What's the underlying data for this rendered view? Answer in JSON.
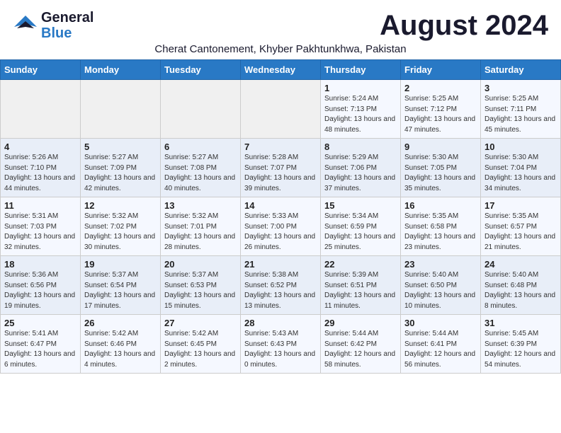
{
  "header": {
    "logo_general": "General",
    "logo_blue": "Blue",
    "month_title": "August 2024",
    "location": "Cherat Cantonement, Khyber Pakhtunkhwa, Pakistan"
  },
  "calendar": {
    "weekdays": [
      "Sunday",
      "Monday",
      "Tuesday",
      "Wednesday",
      "Thursday",
      "Friday",
      "Saturday"
    ],
    "weeks": [
      [
        {
          "day": "",
          "sunrise": "",
          "sunset": "",
          "daylight": ""
        },
        {
          "day": "",
          "sunrise": "",
          "sunset": "",
          "daylight": ""
        },
        {
          "day": "",
          "sunrise": "",
          "sunset": "",
          "daylight": ""
        },
        {
          "day": "",
          "sunrise": "",
          "sunset": "",
          "daylight": ""
        },
        {
          "day": "1",
          "sunrise": "Sunrise: 5:24 AM",
          "sunset": "Sunset: 7:13 PM",
          "daylight": "Daylight: 13 hours and 48 minutes."
        },
        {
          "day": "2",
          "sunrise": "Sunrise: 5:25 AM",
          "sunset": "Sunset: 7:12 PM",
          "daylight": "Daylight: 13 hours and 47 minutes."
        },
        {
          "day": "3",
          "sunrise": "Sunrise: 5:25 AM",
          "sunset": "Sunset: 7:11 PM",
          "daylight": "Daylight: 13 hours and 45 minutes."
        }
      ],
      [
        {
          "day": "4",
          "sunrise": "Sunrise: 5:26 AM",
          "sunset": "Sunset: 7:10 PM",
          "daylight": "Daylight: 13 hours and 44 minutes."
        },
        {
          "day": "5",
          "sunrise": "Sunrise: 5:27 AM",
          "sunset": "Sunset: 7:09 PM",
          "daylight": "Daylight: 13 hours and 42 minutes."
        },
        {
          "day": "6",
          "sunrise": "Sunrise: 5:27 AM",
          "sunset": "Sunset: 7:08 PM",
          "daylight": "Daylight: 13 hours and 40 minutes."
        },
        {
          "day": "7",
          "sunrise": "Sunrise: 5:28 AM",
          "sunset": "Sunset: 7:07 PM",
          "daylight": "Daylight: 13 hours and 39 minutes."
        },
        {
          "day": "8",
          "sunrise": "Sunrise: 5:29 AM",
          "sunset": "Sunset: 7:06 PM",
          "daylight": "Daylight: 13 hours and 37 minutes."
        },
        {
          "day": "9",
          "sunrise": "Sunrise: 5:30 AM",
          "sunset": "Sunset: 7:05 PM",
          "daylight": "Daylight: 13 hours and 35 minutes."
        },
        {
          "day": "10",
          "sunrise": "Sunrise: 5:30 AM",
          "sunset": "Sunset: 7:04 PM",
          "daylight": "Daylight: 13 hours and 34 minutes."
        }
      ],
      [
        {
          "day": "11",
          "sunrise": "Sunrise: 5:31 AM",
          "sunset": "Sunset: 7:03 PM",
          "daylight": "Daylight: 13 hours and 32 minutes."
        },
        {
          "day": "12",
          "sunrise": "Sunrise: 5:32 AM",
          "sunset": "Sunset: 7:02 PM",
          "daylight": "Daylight: 13 hours and 30 minutes."
        },
        {
          "day": "13",
          "sunrise": "Sunrise: 5:32 AM",
          "sunset": "Sunset: 7:01 PM",
          "daylight": "Daylight: 13 hours and 28 minutes."
        },
        {
          "day": "14",
          "sunrise": "Sunrise: 5:33 AM",
          "sunset": "Sunset: 7:00 PM",
          "daylight": "Daylight: 13 hours and 26 minutes."
        },
        {
          "day": "15",
          "sunrise": "Sunrise: 5:34 AM",
          "sunset": "Sunset: 6:59 PM",
          "daylight": "Daylight: 13 hours and 25 minutes."
        },
        {
          "day": "16",
          "sunrise": "Sunrise: 5:35 AM",
          "sunset": "Sunset: 6:58 PM",
          "daylight": "Daylight: 13 hours and 23 minutes."
        },
        {
          "day": "17",
          "sunrise": "Sunrise: 5:35 AM",
          "sunset": "Sunset: 6:57 PM",
          "daylight": "Daylight: 13 hours and 21 minutes."
        }
      ],
      [
        {
          "day": "18",
          "sunrise": "Sunrise: 5:36 AM",
          "sunset": "Sunset: 6:56 PM",
          "daylight": "Daylight: 13 hours and 19 minutes."
        },
        {
          "day": "19",
          "sunrise": "Sunrise: 5:37 AM",
          "sunset": "Sunset: 6:54 PM",
          "daylight": "Daylight: 13 hours and 17 minutes."
        },
        {
          "day": "20",
          "sunrise": "Sunrise: 5:37 AM",
          "sunset": "Sunset: 6:53 PM",
          "daylight": "Daylight: 13 hours and 15 minutes."
        },
        {
          "day": "21",
          "sunrise": "Sunrise: 5:38 AM",
          "sunset": "Sunset: 6:52 PM",
          "daylight": "Daylight: 13 hours and 13 minutes."
        },
        {
          "day": "22",
          "sunrise": "Sunrise: 5:39 AM",
          "sunset": "Sunset: 6:51 PM",
          "daylight": "Daylight: 13 hours and 11 minutes."
        },
        {
          "day": "23",
          "sunrise": "Sunrise: 5:40 AM",
          "sunset": "Sunset: 6:50 PM",
          "daylight": "Daylight: 13 hours and 10 minutes."
        },
        {
          "day": "24",
          "sunrise": "Sunrise: 5:40 AM",
          "sunset": "Sunset: 6:48 PM",
          "daylight": "Daylight: 13 hours and 8 minutes."
        }
      ],
      [
        {
          "day": "25",
          "sunrise": "Sunrise: 5:41 AM",
          "sunset": "Sunset: 6:47 PM",
          "daylight": "Daylight: 13 hours and 6 minutes."
        },
        {
          "day": "26",
          "sunrise": "Sunrise: 5:42 AM",
          "sunset": "Sunset: 6:46 PM",
          "daylight": "Daylight: 13 hours and 4 minutes."
        },
        {
          "day": "27",
          "sunrise": "Sunrise: 5:42 AM",
          "sunset": "Sunset: 6:45 PM",
          "daylight": "Daylight: 13 hours and 2 minutes."
        },
        {
          "day": "28",
          "sunrise": "Sunrise: 5:43 AM",
          "sunset": "Sunset: 6:43 PM",
          "daylight": "Daylight: 13 hours and 0 minutes."
        },
        {
          "day": "29",
          "sunrise": "Sunrise: 5:44 AM",
          "sunset": "Sunset: 6:42 PM",
          "daylight": "Daylight: 12 hours and 58 minutes."
        },
        {
          "day": "30",
          "sunrise": "Sunrise: 5:44 AM",
          "sunset": "Sunset: 6:41 PM",
          "daylight": "Daylight: 12 hours and 56 minutes."
        },
        {
          "day": "31",
          "sunrise": "Sunrise: 5:45 AM",
          "sunset": "Sunset: 6:39 PM",
          "daylight": "Daylight: 12 hours and 54 minutes."
        }
      ]
    ]
  }
}
